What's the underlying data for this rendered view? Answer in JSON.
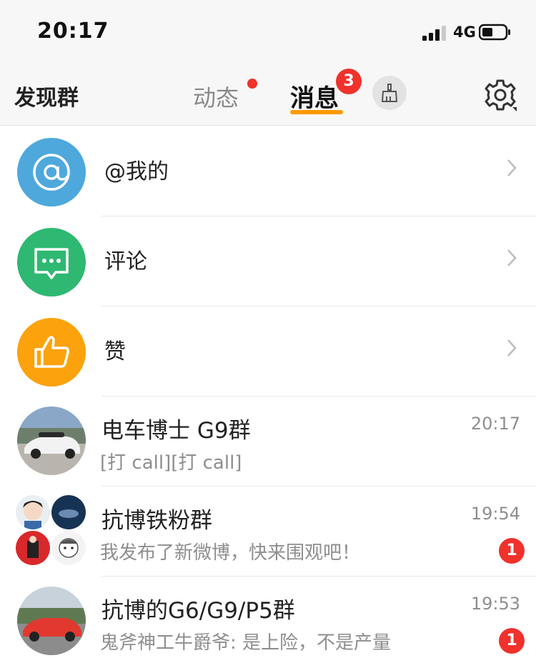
{
  "status_bar": {
    "time": "20:17",
    "network": "4G"
  },
  "nav": {
    "left_title": "发现群",
    "tabs": [
      {
        "label": "动态",
        "has_dot": true
      },
      {
        "label": "消息",
        "badge": "3"
      }
    ],
    "clean_icon": "broom-icon",
    "settings_icon": "gear-icon"
  },
  "menu_items": [
    {
      "label": "@我的",
      "icon": "at-icon",
      "color": "#4ea8dc"
    },
    {
      "label": "评论",
      "icon": "comment-icon",
      "color": "#2fb872"
    },
    {
      "label": "赞",
      "icon": "thumbs-up-icon",
      "color": "#fba20c"
    }
  ],
  "chats": [
    {
      "title": "电车博士 G9群",
      "preview": "[打 call][打 call]",
      "time": "20:17",
      "unread": ""
    },
    {
      "title": "抗博铁粉群",
      "preview": "我发布了新微博，快来围观吧！",
      "time": "19:54",
      "unread": "1"
    },
    {
      "title": "抗博的G6/G9/P5群",
      "preview": "鬼斧神工牛爵爷: 是上险，不是产量",
      "time": "19:53",
      "unread": "1"
    }
  ],
  "colors": {
    "accent_orange": "#ff9a00",
    "badge_red": "#f0312c",
    "secondary_text": "#8e8e8e"
  }
}
